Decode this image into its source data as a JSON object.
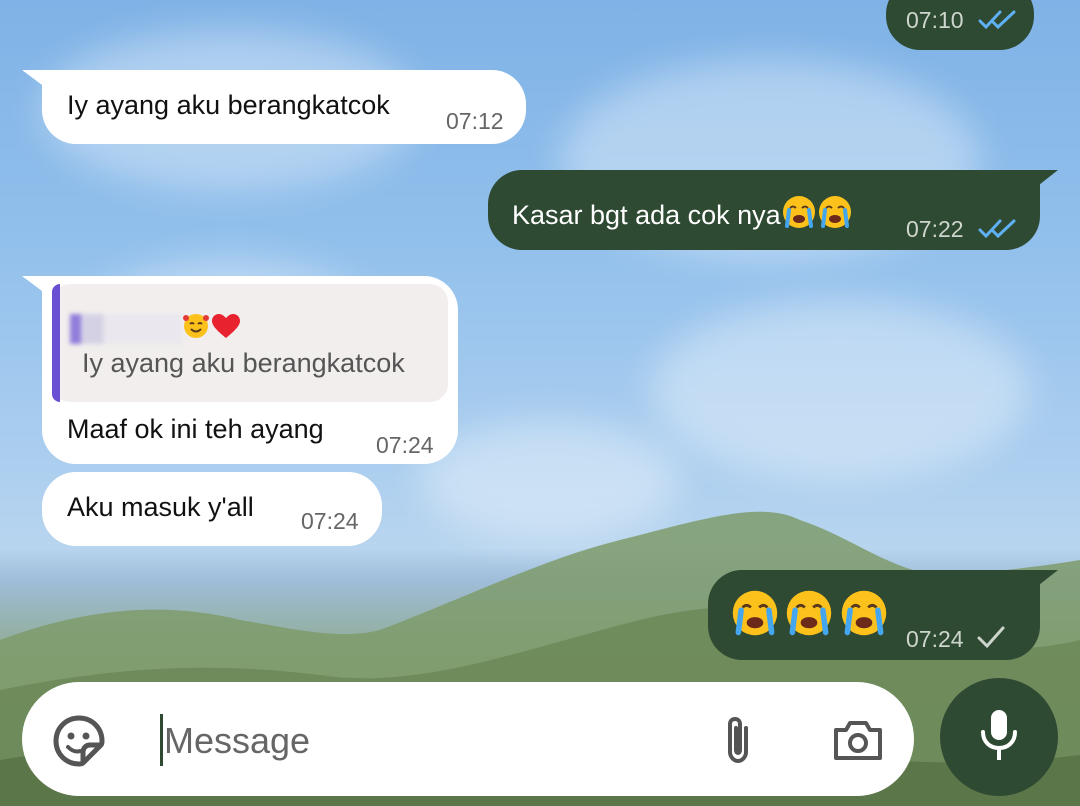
{
  "messages": [
    {
      "direction": "out",
      "time": "07:10",
      "status": "read"
    },
    {
      "direction": "in",
      "text": "Iy ayang aku berangkatcok",
      "time": "07:12"
    },
    {
      "direction": "out",
      "text": "Kasar bgt ada cok nya",
      "emojis": [
        "crying-face",
        "crying-face"
      ],
      "time": "07:22",
      "status": "read"
    },
    {
      "direction": "in",
      "quote": {
        "sender_emojis": [
          "smiling-face-with-hearts",
          "red-heart"
        ],
        "text": "Iy ayang aku berangkatcok"
      },
      "text": "Maaf ok ini teh ayang",
      "time": "07:24"
    },
    {
      "direction": "in",
      "text": "Aku masuk y'all",
      "time": "07:24"
    },
    {
      "direction": "out",
      "emojis": [
        "crying-face",
        "crying-face",
        "crying-face"
      ],
      "time": "07:24",
      "status": "sent"
    }
  ],
  "composer": {
    "placeholder": "Message",
    "icons": [
      "sticker-icon",
      "attach-icon",
      "camera-icon",
      "mic-icon"
    ]
  },
  "colors": {
    "outgoing_bubble": "#2f4a32",
    "incoming_bubble": "#ffffff",
    "read_tick": "#5fb0f5",
    "quote_bar": "#6b4fd3"
  }
}
